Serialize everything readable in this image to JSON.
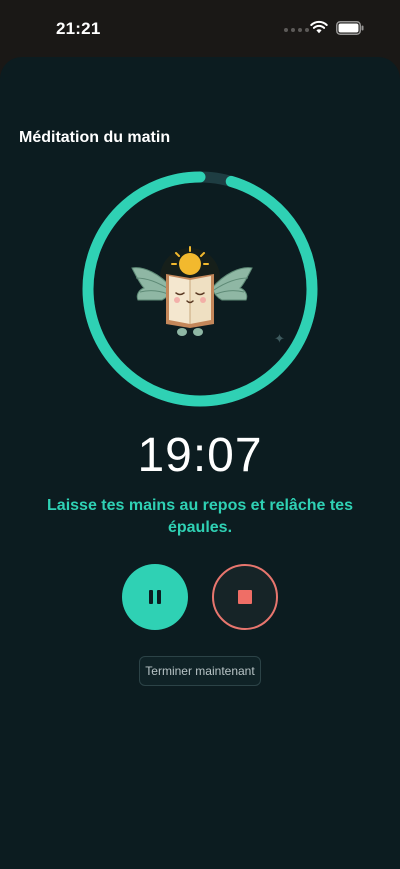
{
  "status_bar": {
    "time": "21:21",
    "icons": [
      "signal-dots-icon",
      "wifi-icon",
      "battery-icon"
    ]
  },
  "session": {
    "title": "Méditation du matin",
    "timer": "19:07",
    "instruction": "Laisse tes mains au repos et relâche tes épaules.",
    "progress": 0.955
  },
  "controls": {
    "pause_icon": "pause-icon",
    "stop_icon": "stop-icon",
    "finish_label": "Terminer maintenant"
  },
  "colors": {
    "accent": "#2fd1b4",
    "stop": "#ef6e66",
    "background": "#0c1c20",
    "ring_track": "#1e3d42"
  }
}
